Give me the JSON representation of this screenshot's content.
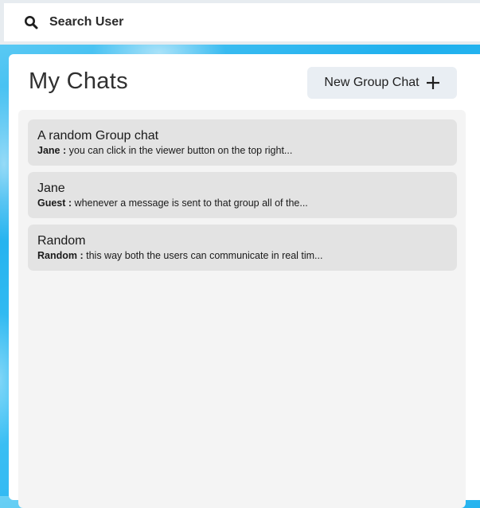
{
  "search": {
    "label": "Search User",
    "icon": "search-icon"
  },
  "header": {
    "title": "My Chats",
    "new_group_label": "New Group Chat",
    "new_group_icon": "plus-icon"
  },
  "chats": [
    {
      "name": "A random Group chat",
      "sender": "Jane :",
      "preview": "you can click in the viewer button on the top right..."
    },
    {
      "name": "Jane",
      "sender": "Guest :",
      "preview": "whenever a message is sent to that group all of the..."
    },
    {
      "name": "Random",
      "sender": "Random :",
      "preview": "this way both the users can communicate in real tim..."
    }
  ],
  "colors": {
    "background_accent": "#1fb0ee",
    "panel": "#ffffff",
    "chat_area": "#f4f4f4",
    "chat_item": "#e3e3e3",
    "button_bg": "#e9eef3"
  }
}
